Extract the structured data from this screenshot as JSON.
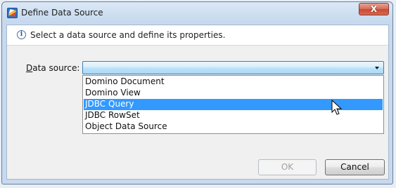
{
  "window": {
    "title": "Define Data Source",
    "close_label": "X",
    "icons": {
      "app": "define-data-source-app-icon",
      "close": "close-icon"
    }
  },
  "info": {
    "icon": "info-icon",
    "icon_glyph": "i",
    "text": "Select a data source and define its properties."
  },
  "data_source": {
    "label_mnemonic": "D",
    "label_rest": "ata source:",
    "selected_value": "",
    "options": [
      "Domino Document",
      "Domino View",
      "JDBC Query",
      "JDBC RowSet",
      "Object Data Source"
    ],
    "highlighted_option": "JDBC Query"
  },
  "buttons": {
    "ok": "OK",
    "cancel": "Cancel"
  },
  "colors": {
    "highlight": "#3399ff",
    "combo_border": "#3c7fb1",
    "close_button": "#c64a34"
  }
}
